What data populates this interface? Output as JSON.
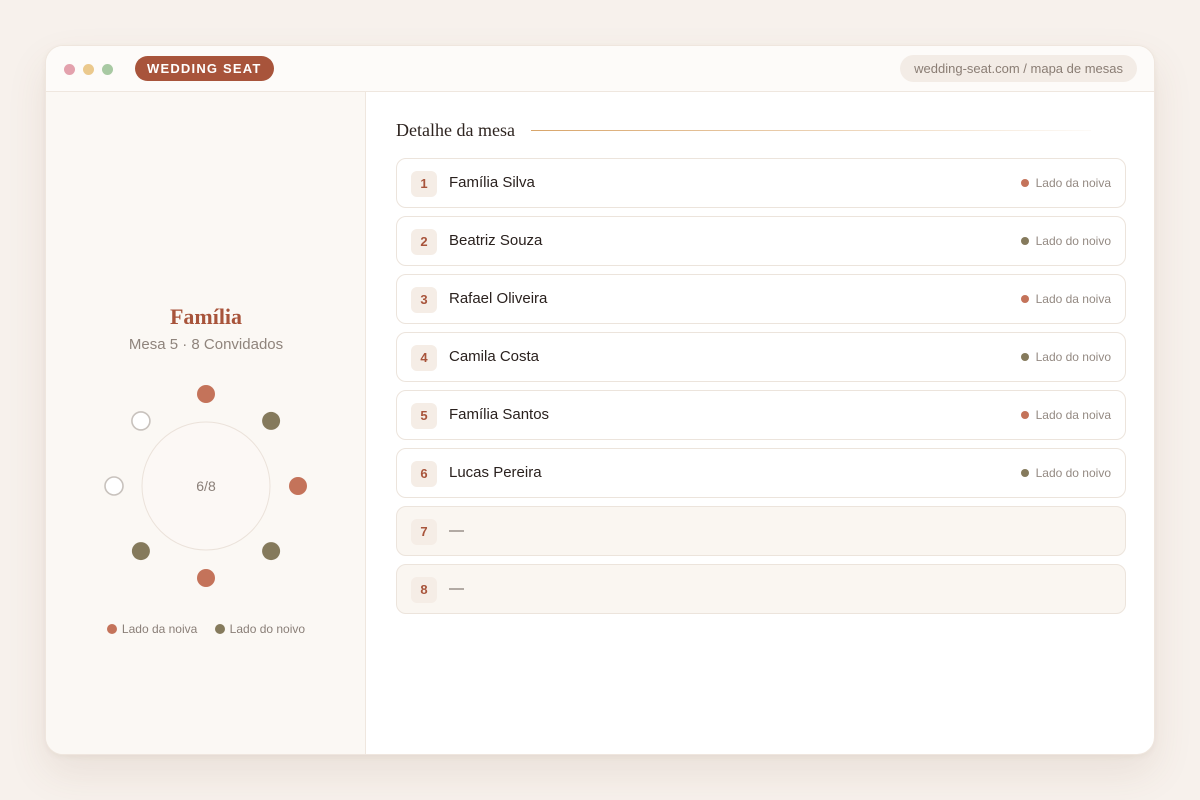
{
  "app": {
    "brand": "WEDDING SEAT",
    "url": "wedding-seat.com / mapa de mesas"
  },
  "colors": {
    "bride": "#c4735a",
    "groom": "#857a5c",
    "empty": "#c8c2bd",
    "accent": "#a8543b"
  },
  "sidebar": {
    "table_name": "Família",
    "table_subtitle": "Mesa 5 · 8 Convidados",
    "occupancy": "6/8",
    "occupied": 6,
    "capacity": 8,
    "seats": [
      {
        "seat": 1,
        "side": "bride"
      },
      {
        "seat": 2,
        "side": "groom"
      },
      {
        "seat": 3,
        "side": "bride"
      },
      {
        "seat": 4,
        "side": "groom"
      },
      {
        "seat": 5,
        "side": "bride"
      },
      {
        "seat": 6,
        "side": "groom"
      },
      {
        "seat": 7,
        "side": "empty"
      },
      {
        "seat": 8,
        "side": "empty"
      }
    ],
    "legend": {
      "bride_label": "Lado da noiva",
      "groom_label": "Lado do noivo"
    }
  },
  "main": {
    "title": "Detalhe da mesa",
    "guests": [
      {
        "num": "1",
        "name": "Família Silva",
        "side": "bride",
        "side_label": "Lado da noiva"
      },
      {
        "num": "2",
        "name": "Beatriz Souza",
        "side": "groom",
        "side_label": "Lado do noivo"
      },
      {
        "num": "3",
        "name": "Rafael Oliveira",
        "side": "bride",
        "side_label": "Lado da noiva"
      },
      {
        "num": "4",
        "name": "Camila Costa",
        "side": "groom",
        "side_label": "Lado do noivo"
      },
      {
        "num": "5",
        "name": "Família Santos",
        "side": "bride",
        "side_label": "Lado da noiva"
      },
      {
        "num": "6",
        "name": "Lucas Pereira",
        "side": "groom",
        "side_label": "Lado do noivo"
      },
      {
        "num": "7",
        "name": "—",
        "side": "empty",
        "side_label": ""
      },
      {
        "num": "8",
        "name": "—",
        "side": "empty",
        "side_label": ""
      }
    ]
  }
}
